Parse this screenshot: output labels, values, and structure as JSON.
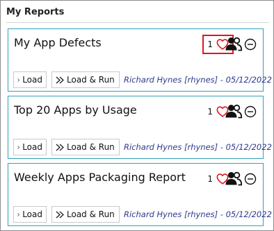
{
  "panel": {
    "title": "My Reports"
  },
  "colors": {
    "card_border": "#33a1b8",
    "heart": "#e0141e",
    "highlight_box": "#e0141e",
    "meta_text": "#2e3a8c"
  },
  "icons": {
    "like": "heart-icon",
    "owners": "users-icon",
    "remove": "minus-circle-icon",
    "load": "chevron-right-icon",
    "load_run": "double-chevron-right-icon"
  },
  "reports": [
    {
      "title": "My App Defects",
      "likes": "1",
      "load_label": "Load",
      "load_run_label": "Load & Run",
      "meta": "Richard Hynes [rhynes] - 05/12/2022"
    },
    {
      "title": "Top 20 Apps by Usage",
      "likes": "1",
      "load_label": "Load",
      "load_run_label": "Load & Run",
      "meta": "Richard Hynes [rhynes] - 05/12/2022"
    },
    {
      "title": "Weekly Apps Packaging Report",
      "likes": "1",
      "load_label": "Load",
      "load_run_label": "Load & Run",
      "meta": "Richard Hynes [rhynes] - 05/12/2022"
    }
  ]
}
